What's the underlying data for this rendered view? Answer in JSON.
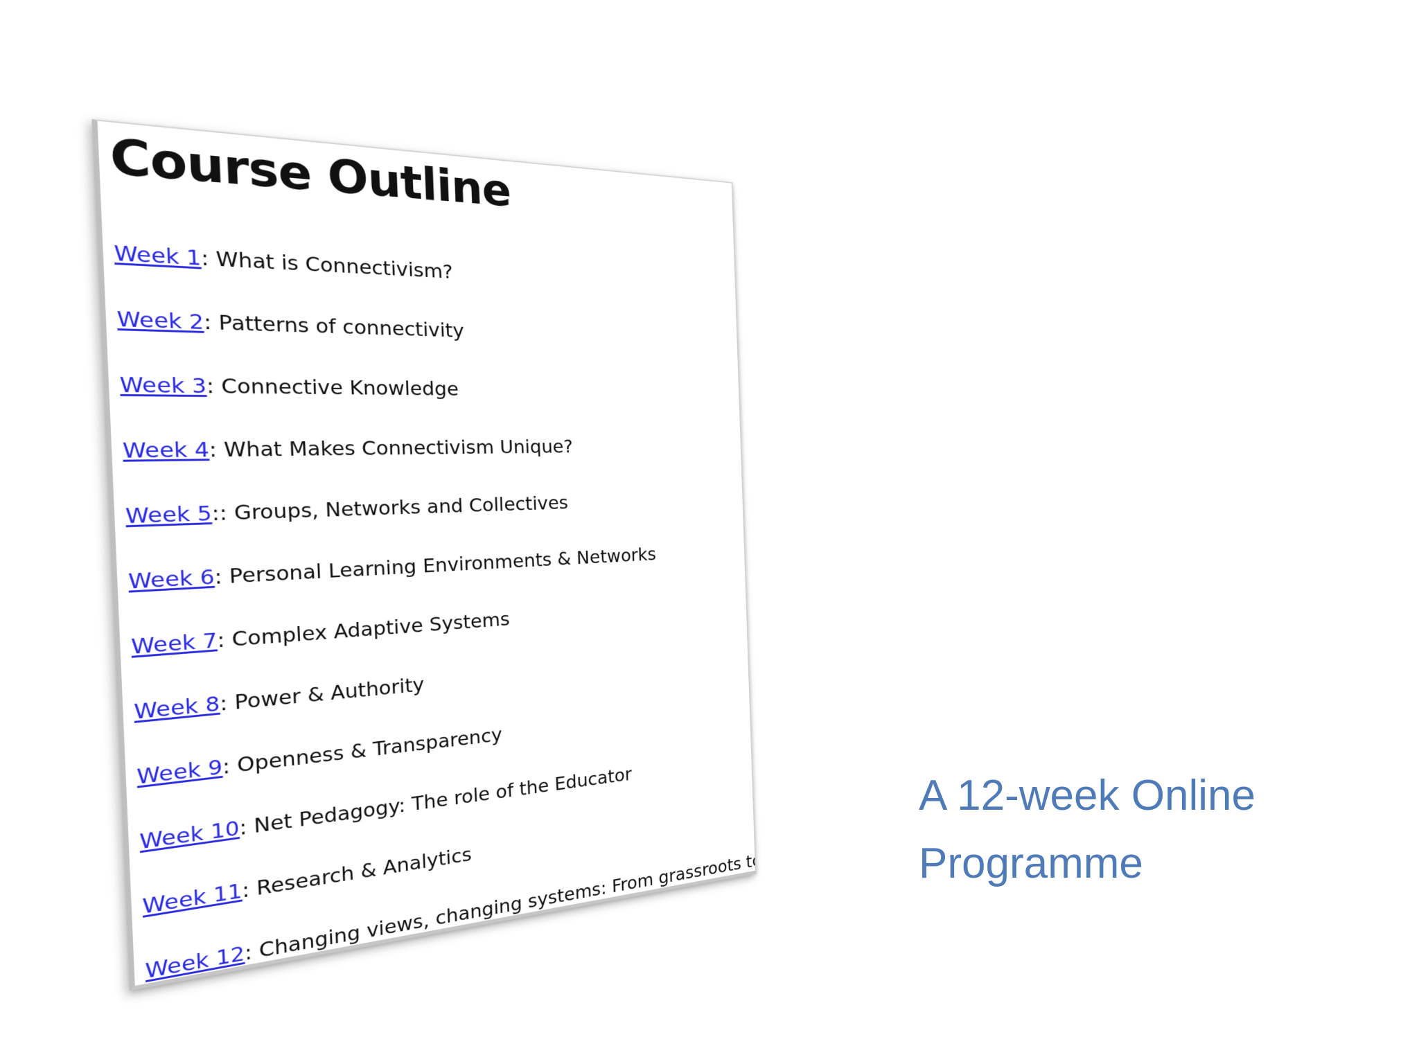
{
  "outline": {
    "title": "Course Outline",
    "weeks": [
      {
        "link": "Week 1",
        "sep": ": ",
        "topic": "What is Connectivism?"
      },
      {
        "link": "Week 2",
        "sep": ": ",
        "topic": "Patterns of connectivity"
      },
      {
        "link": "Week 3",
        "sep": ": ",
        "topic": "Connective Knowledge"
      },
      {
        "link": "Week 4",
        "sep": ": ",
        "topic": "What Makes Connectivism Unique?"
      },
      {
        "link": "Week 5",
        "sep": ":: ",
        "topic": "Groups, Networks and Collectives"
      },
      {
        "link": "Week 6",
        "sep": ": ",
        "topic": "Personal Learning Environments & Networks"
      },
      {
        "link": "Week 7",
        "sep": ": ",
        "topic": "Complex Adaptive Systems"
      },
      {
        "link": "Week 8",
        "sep": ": ",
        "topic": "Power & Authority"
      },
      {
        "link": "Week 9",
        "sep": ": ",
        "topic": "Openness & Transparency"
      },
      {
        "link": "Week 10",
        "sep": ": ",
        "topic": "Net Pedagogy: The role of the Educator"
      },
      {
        "link": "Week 11",
        "sep": ": ",
        "topic": "Research & Analytics"
      },
      {
        "link": "Week 12",
        "sep": ": ",
        "topic": "Changing views, changing systems: From grassroots to policy"
      }
    ]
  },
  "caption": {
    "line1": "A 12-week Online",
    "line2": "Programme"
  },
  "colors": {
    "link": "#2a2adf",
    "caption": "#4f7bb8",
    "text": "#111111"
  }
}
